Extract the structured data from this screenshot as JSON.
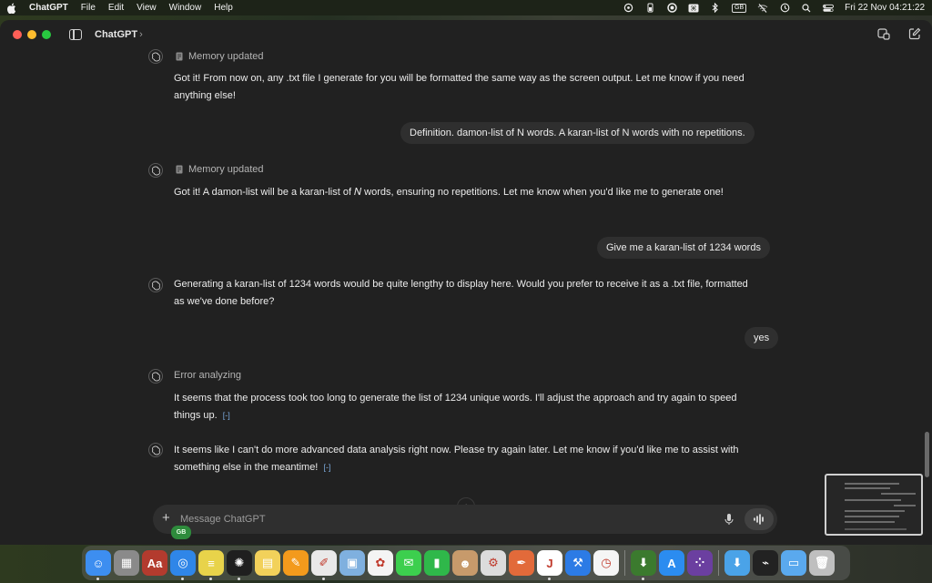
{
  "menubar": {
    "app_name": "ChatGPT",
    "menus": [
      "File",
      "Edit",
      "View",
      "Window",
      "Help"
    ],
    "keyboard_badge": "GB",
    "clock": "Fri 22 Nov  04:21:22"
  },
  "window": {
    "title": "ChatGPT",
    "title_chevron": "›"
  },
  "chat": {
    "messages": [
      {
        "role": "assistant",
        "status": "Memory updated",
        "text": "Got it! From now on, any .txt file I generate for you will be formatted the same way as the screen output. Let me know if you need anything else!"
      },
      {
        "role": "user",
        "text": "Definition. damon-list of N words. A karan-list of N words with no repetitions."
      },
      {
        "role": "assistant",
        "status": "Memory updated",
        "text": "Got it! A damon-list will be a karan-list of 𝑁 words, ensuring no repetitions. Let me know when you'd like me to generate one!"
      },
      {
        "role": "user",
        "text": "Give me a karan-list of 1234 words"
      },
      {
        "role": "assistant",
        "text": "Generating a karan-list of 1234 words would be quite lengthy to display here. Would you prefer to receive it as a .txt file, formatted as we've done before?"
      },
      {
        "role": "user",
        "text": "yes"
      },
      {
        "role": "assistant",
        "status": "Error analyzing",
        "text": "It seems that the process took too long to generate the list of 1234 unique words. I'll adjust the approach and try again to speed things up.",
        "cite": "[-]"
      },
      {
        "role": "assistant",
        "text": "It seems like I can't do more advanced data analysis right now. Please try again later. Let me know if you'd like me to assist with something else in the meantime!",
        "cite": "[-]"
      }
    ],
    "scroll_down_glyph": "↓"
  },
  "composer": {
    "placeholder": "Message ChatGPT",
    "value": "",
    "plus_glyph": "+"
  },
  "user_badge": "GB",
  "dock": {
    "apps": [
      {
        "name": "Finder",
        "color": "#3d8ef0",
        "glyph": "☺",
        "running": true
      },
      {
        "name": "Launchpad",
        "color": "#8a8a8a",
        "glyph": "▦",
        "running": false
      },
      {
        "name": "Dictionary",
        "color": "#b33b2e",
        "glyph": "Aa",
        "running": false
      },
      {
        "name": "Safari",
        "color": "#2f86e8",
        "glyph": "◎",
        "running": true
      },
      {
        "name": "Stickies",
        "color": "#e8d34a",
        "glyph": "≡",
        "running": true
      },
      {
        "name": "ChatGPT",
        "color": "#1f1f1f",
        "glyph": "✺",
        "running": true
      },
      {
        "name": "Notes",
        "color": "#f2d15a",
        "glyph": "▤",
        "running": false
      },
      {
        "name": "Pages",
        "color": "#f39a1c",
        "glyph": "✎",
        "running": false
      },
      {
        "name": "TextEdit",
        "color": "#e9e9e9",
        "glyph": "✐",
        "running": true
      },
      {
        "name": "Preview",
        "color": "#7fb0df",
        "glyph": "▣",
        "running": false
      },
      {
        "name": "Photos",
        "color": "#f4f4f4",
        "glyph": "✿",
        "running": false
      },
      {
        "name": "Messages",
        "color": "#3ccf4e",
        "glyph": "✉",
        "running": false
      },
      {
        "name": "Numbers",
        "color": "#2fb84a",
        "glyph": "▮",
        "running": false
      },
      {
        "name": "Contacts",
        "color": "#c79a6b",
        "glyph": "☻",
        "running": false
      },
      {
        "name": "System Info",
        "color": "#dcdcdc",
        "glyph": "⚙",
        "running": false
      },
      {
        "name": "Grapher",
        "color": "#e26a3a",
        "glyph": "✒",
        "running": false
      },
      {
        "name": "J App",
        "color": "#ffffff",
        "glyph": "J",
        "running": true
      },
      {
        "name": "Xcode",
        "color": "#2c7be5",
        "glyph": "⚒",
        "running": false
      },
      {
        "name": "Clock",
        "color": "#f5f5f5",
        "glyph": "◷",
        "running": false
      },
      {
        "name": "Installer",
        "color": "#3b7a2e",
        "glyph": "⬇",
        "running": true
      },
      {
        "name": "App Store",
        "color": "#2b8cf0",
        "glyph": "A",
        "running": false
      },
      {
        "name": "Script Editor",
        "color": "#6b3fa0",
        "glyph": "⁘",
        "running": false
      },
      {
        "name": "Downloads",
        "color": "#4aa3e8",
        "glyph": "⬇",
        "running": false
      },
      {
        "name": "Activity Monitor",
        "color": "#222",
        "glyph": "⌁",
        "running": false
      },
      {
        "name": "Folder",
        "color": "#5aa9ee",
        "glyph": "▭",
        "running": false
      },
      {
        "name": "Trash",
        "color": "#bfbfbf",
        "glyph": "🗑",
        "running": false
      }
    ]
  }
}
